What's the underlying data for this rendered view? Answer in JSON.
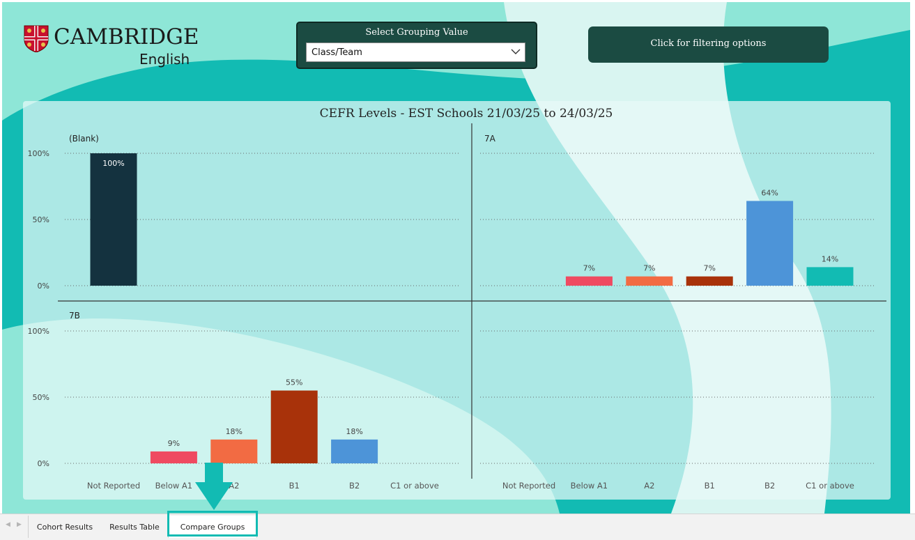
{
  "logo": {
    "name": "CAMBRIDGE",
    "sub": "English"
  },
  "slicer": {
    "title": "Select Grouping Value",
    "value": "Class/Team"
  },
  "filter_button": {
    "label": "Click for filtering options"
  },
  "tabs": [
    "Cohort Results",
    "Results Table",
    "Compare Groups"
  ],
  "active_tab": "Compare Groups",
  "colors": {
    "background": "#12bbb3",
    "dark_green": "#1b4b42",
    "not_reported": "#14323f",
    "below_a1": "#ef4a61",
    "a2": "#f26b43",
    "b1": "#a8320a",
    "b2": "#4d94d8",
    "c1_or_above": "#12bbb3"
  },
  "chart_data": {
    "type": "bar",
    "title": "CEFR Levels - EST Schools 21/03/25 to 24/03/25",
    "categories": [
      "Not Reported",
      "Below A1",
      "A2",
      "B1",
      "B2",
      "C1 or above"
    ],
    "yticks": [
      "100%",
      "50%",
      "0%"
    ],
    "ylim": [
      0,
      100
    ],
    "grid": true,
    "panels": [
      {
        "name": "(Blank)",
        "values": [
          100,
          null,
          null,
          null,
          null,
          null
        ],
        "labels": [
          "100%",
          "",
          "",
          "",
          "",
          ""
        ]
      },
      {
        "name": "7A",
        "values": [
          null,
          7,
          7,
          7,
          64,
          14
        ],
        "labels": [
          "",
          "7%",
          "7%",
          "7%",
          "64%",
          "14%"
        ]
      },
      {
        "name": "7B",
        "values": [
          null,
          9,
          18,
          55,
          18,
          null
        ],
        "labels": [
          "",
          "9%",
          "18%",
          "55%",
          "18%",
          ""
        ]
      },
      {
        "name": "",
        "values": [
          null,
          null,
          null,
          null,
          null,
          null
        ],
        "labels": [
          "",
          "",
          "",
          "",
          "",
          ""
        ]
      }
    ]
  }
}
